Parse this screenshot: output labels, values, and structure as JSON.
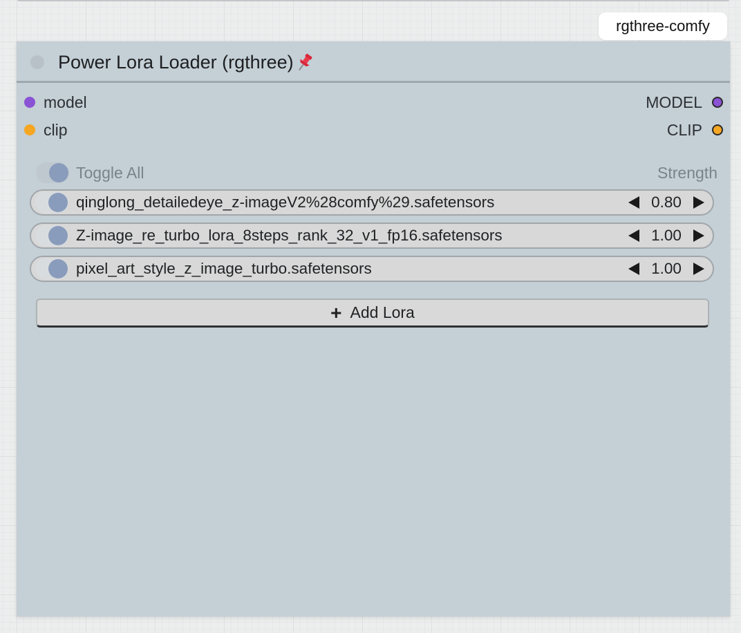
{
  "badge": {
    "label": "rgthree-comfy"
  },
  "node": {
    "title": "Power Lora Loader (rgthree)",
    "title_icon": "pushpin-icon",
    "inputs": [
      {
        "label": "model",
        "color": "#8a52d4"
      },
      {
        "label": "clip",
        "color": "#f5a623"
      }
    ],
    "outputs": [
      {
        "label": "MODEL",
        "color": "#8a52d4"
      },
      {
        "label": "CLIP",
        "color": "#f5a623"
      }
    ],
    "toggle_all_label": "Toggle All",
    "strength_header": "Strength",
    "loras": [
      {
        "name": "qinglong_detailedeye_z-imageV2%28comfy%29.safetensors",
        "strength": "0.80",
        "enabled": true
      },
      {
        "name": "Z-image_re_turbo_lora_8steps_rank_32_v1_fp16.safetensors",
        "strength": "1.00",
        "enabled": true
      },
      {
        "name": "pixel_art_style_z_image_turbo.safetensors",
        "strength": "1.00",
        "enabled": true
      }
    ],
    "add_lora_label": "Add Lora"
  },
  "colors": {
    "node_background": "#c4cfd6",
    "toggle_knob": "#8a9cbc"
  }
}
